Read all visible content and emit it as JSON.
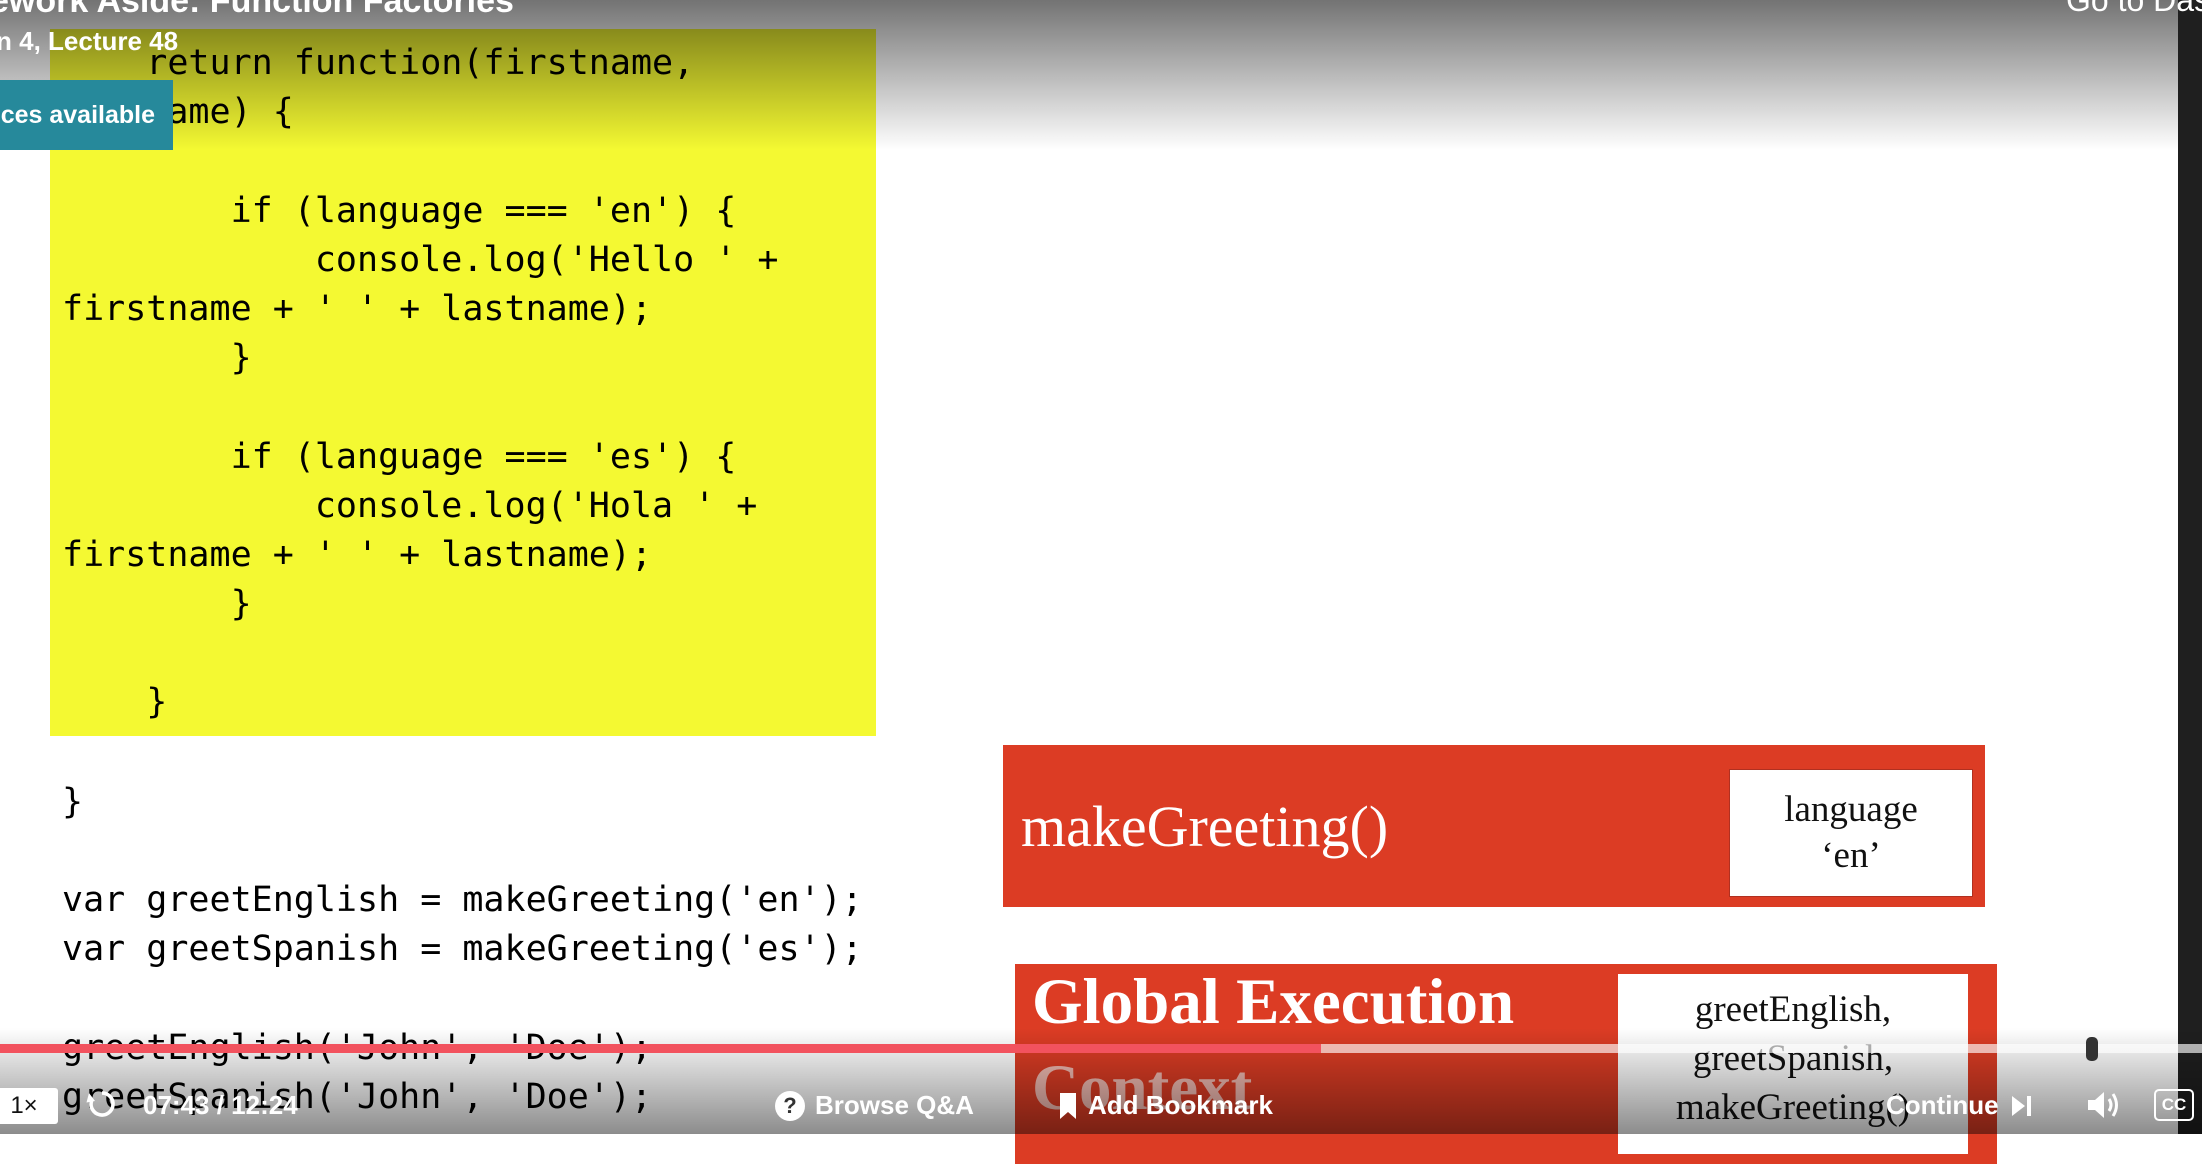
{
  "header": {
    "title": "ework Aside: Function Factories",
    "subtitle": "n 4, Lecture 48",
    "goto_link": "Go to Das",
    "resources_badge": "ces available"
  },
  "code": {
    "lines": [
      "    return function(firstname,",
      "lastname) {",
      "        if (language === 'en') {",
      "            console.log('Hello ' +",
      "firstname + ' ' + lastname);",
      "        }",
      "        if (language === 'es') {",
      "            console.log('Hola ' +",
      "firstname + ' ' + lastname);",
      "        }",
      "    }",
      "}",
      "var greetEnglish = makeGreeting('en');",
      "var greetSpanish = makeGreeting('es');",
      "greetEnglish('John', 'Doe');",
      "greetSpanish('John', 'Doe');"
    ]
  },
  "diagram": {
    "function_context": {
      "label": "makeGreeting()",
      "var_name": "language",
      "var_value": "‘en’"
    },
    "global_context": {
      "label_line1": "Global Execution",
      "label_line2": "Context",
      "vars": [
        "greetEnglish,",
        "greetSpanish,",
        "makeGreeting()"
      ]
    }
  },
  "player": {
    "speed": "1×",
    "time": "07:43 / 12:24",
    "browse_qa": "Browse Q&A",
    "add_bookmark": "Add Bookmark",
    "continue": "Continue",
    "cc": "CC",
    "progress_fraction": 0.6
  },
  "colors": {
    "highlight": "#f4f932",
    "context_red": "#dc3c24",
    "progress_red": "#f2525e",
    "badge_teal": "#26899b"
  }
}
